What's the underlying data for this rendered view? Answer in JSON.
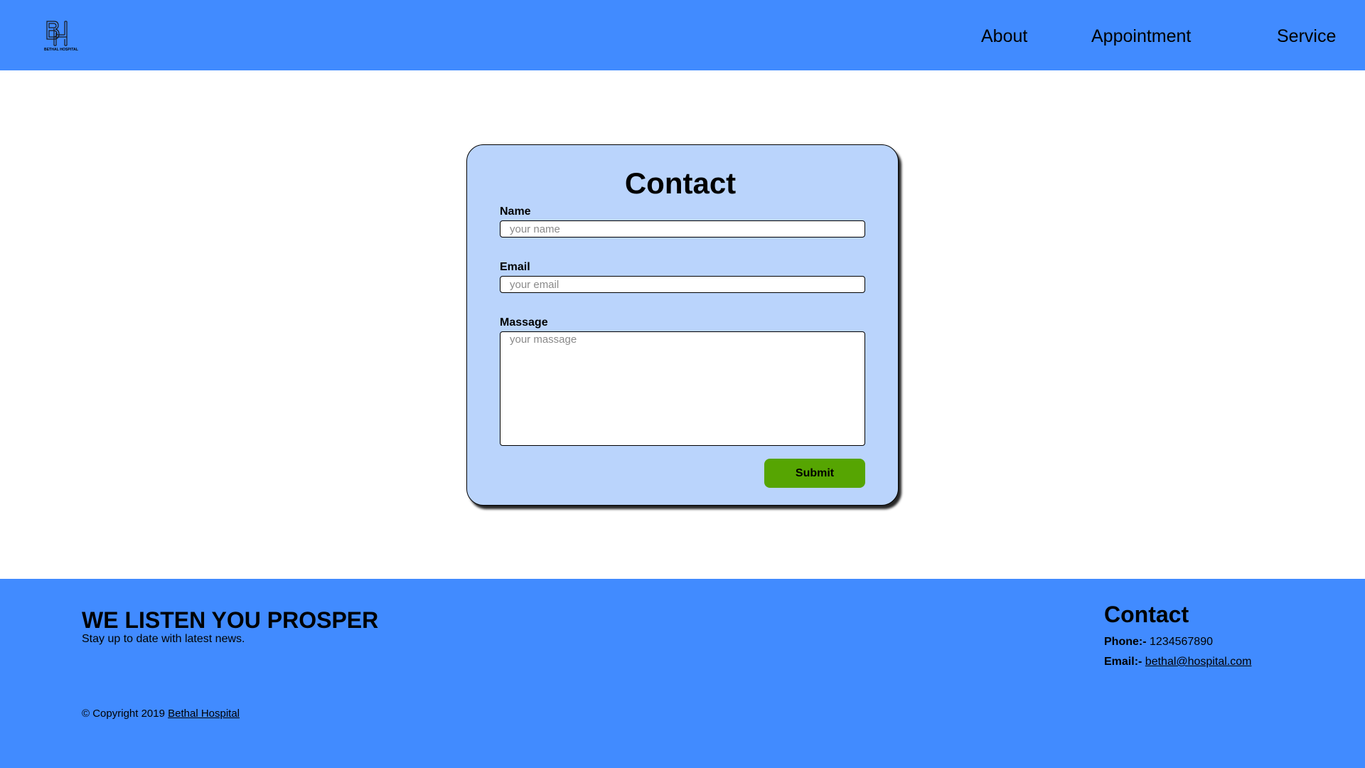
{
  "header": {
    "logo": {
      "text": "BETHAL HOSPITAL",
      "icon": "bh-monogram-icon"
    },
    "nav": [
      {
        "label": "About"
      },
      {
        "label": "Appointment"
      },
      {
        "label": "Service"
      }
    ]
  },
  "contact_form": {
    "title": "Contact",
    "name": {
      "label": "Name",
      "placeholder": "your name",
      "value": ""
    },
    "email": {
      "label": "Email",
      "placeholder": "your email",
      "value": ""
    },
    "message": {
      "label": "Massage",
      "placeholder": "your massage",
      "value": ""
    },
    "submit_label": "Submit"
  },
  "footer": {
    "tagline": "WE LISTEN YOU PROSPER",
    "tagline_sub": "Stay up to date with latest news.",
    "copyright_prefix": "© Copyright 2019",
    "copyright_link": "Bethal Hospital",
    "contact": {
      "title": "Contact",
      "phone_label": "Phone:-",
      "phone_value": "1234567890",
      "email_label": "Email:-",
      "email_value": "bethal@hospital.com"
    }
  },
  "colors": {
    "header_bg": "#418bff",
    "footer_bg": "#418bff",
    "card_bg": "#bad4fc",
    "submit_bg": "#56a502"
  }
}
